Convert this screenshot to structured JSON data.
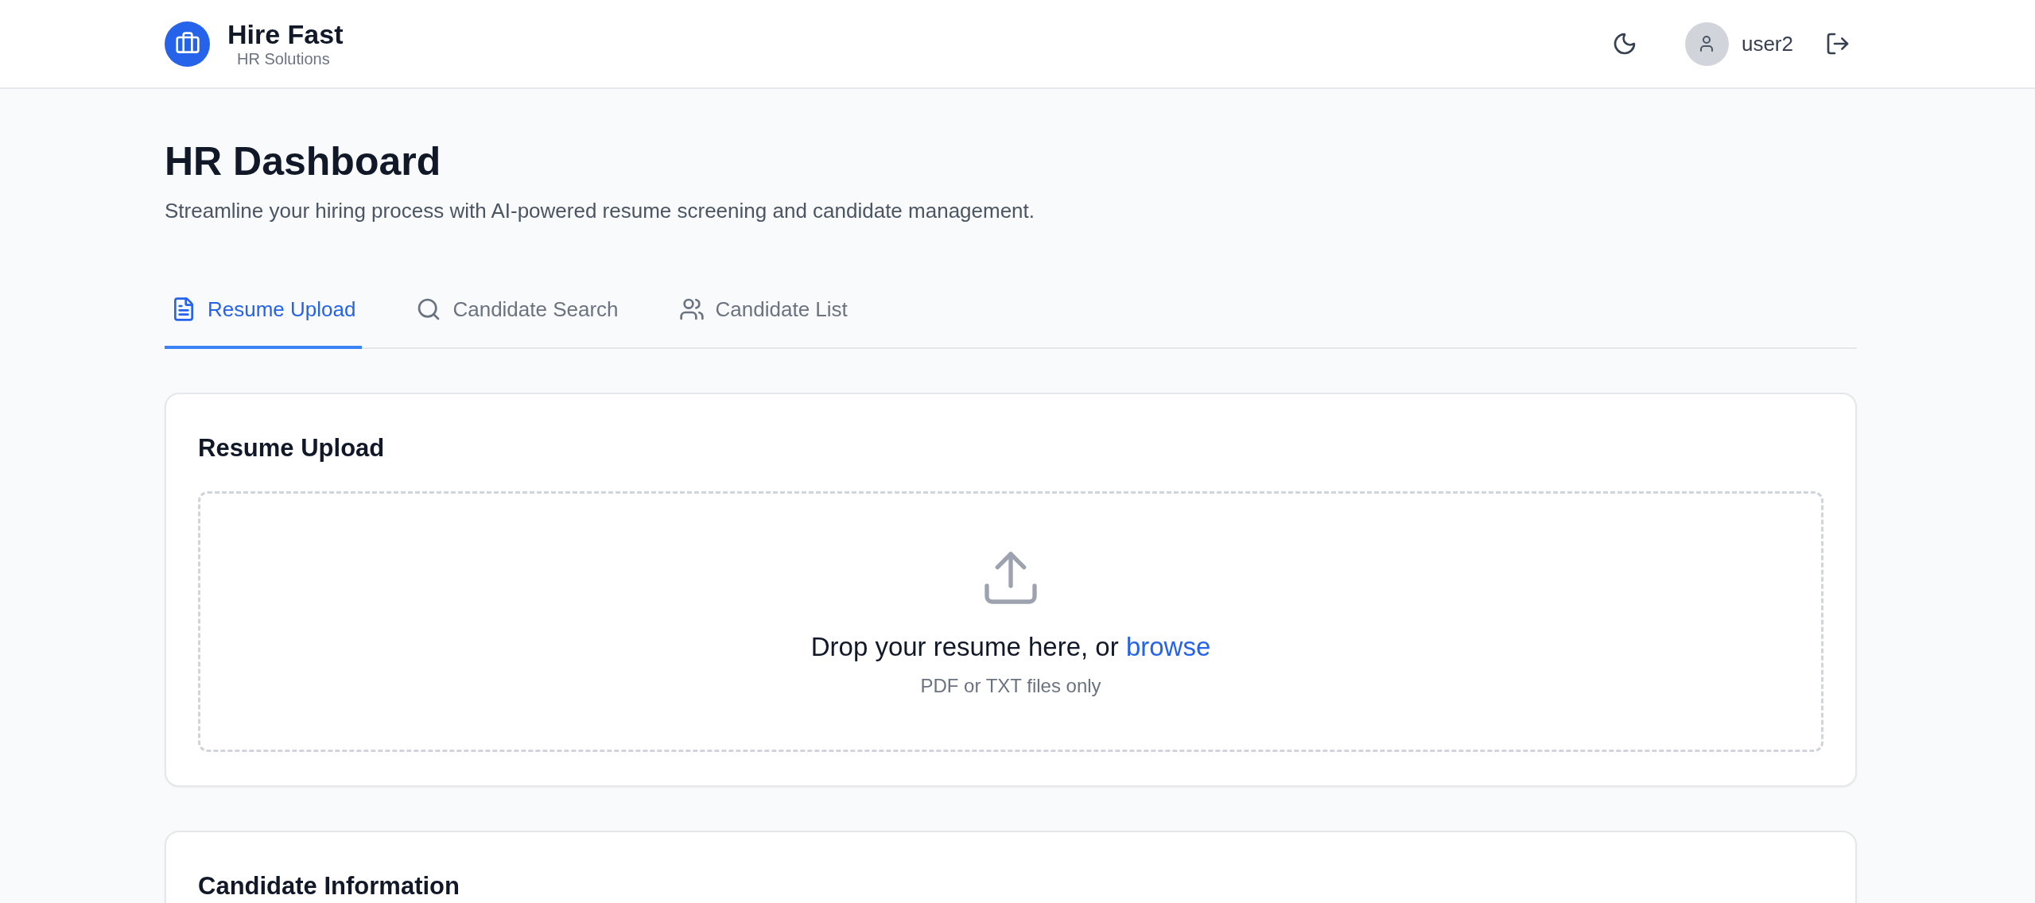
{
  "brand": {
    "name": "Hire Fast",
    "tagline": "HR Solutions"
  },
  "user": {
    "name": "user2"
  },
  "page": {
    "title": "HR Dashboard",
    "subtitle": "Streamline your hiring process with AI-powered resume screening and candidate management."
  },
  "tabs": [
    {
      "label": "Resume Upload",
      "kind": "file",
      "selected": true
    },
    {
      "label": "Candidate Search",
      "kind": "search",
      "selected": false
    },
    {
      "label": "Candidate List",
      "kind": "users",
      "selected": false
    }
  ],
  "upload_card": {
    "title": "Resume Upload",
    "prompt": "Drop your resume here, or",
    "link": "browse",
    "hint": "PDF or TXT files only"
  },
  "info_card": {
    "title": "Candidate Information"
  }
}
